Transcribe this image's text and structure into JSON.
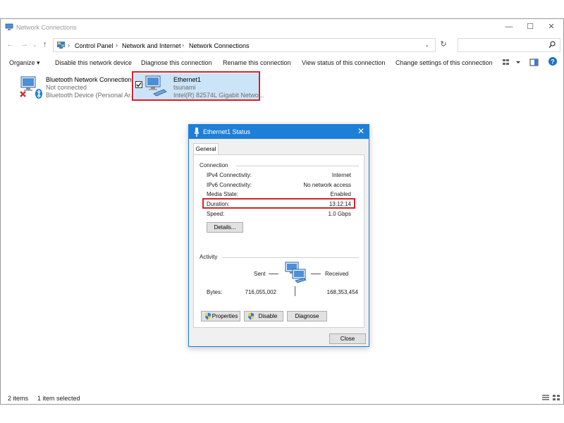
{
  "window": {
    "title": "Network Connections",
    "controls": {
      "minimize": "—",
      "maximize": "☐",
      "close": "✕"
    }
  },
  "address": {
    "crumbs": [
      "Control Panel",
      "Network and Internet",
      "Network Connections"
    ],
    "separator": "›",
    "dropdown": "⌄",
    "refresh": "↻",
    "search_placeholder": ""
  },
  "nav": {
    "back": "←",
    "forward": "→",
    "history": "⌄",
    "up": "↑"
  },
  "commands": {
    "organize": "Organize ▾",
    "disable": "Disable this network device",
    "diagnose": "Diagnose this connection",
    "rename": "Rename this connection",
    "view_status": "View status of this connection",
    "change_settings": "Change settings of this connection"
  },
  "connections": [
    {
      "name": "Bluetooth Network Connection",
      "status": "Not connected",
      "device": "Bluetooth Device (Personal Ar..."
    },
    {
      "name": "Ethernet1",
      "status": "tsunami",
      "device": "Intel(R) 82574L Gigabit Netwo..."
    }
  ],
  "statusbar": {
    "count": "2 items",
    "selected": "1 item selected"
  },
  "dialog": {
    "title": "Ethernet1 Status",
    "close": "✕",
    "tab": "General",
    "connection_group": "Connection",
    "rows": [
      {
        "label": "IPv4 Connectivity:",
        "value": "Internet"
      },
      {
        "label": "IPv6 Connectivity:",
        "value": "No network access"
      },
      {
        "label": "Media State:",
        "value": "Enabled"
      },
      {
        "label": "Duration:",
        "value": "13:12:14"
      },
      {
        "label": "Speed:",
        "value": "1.0 Gbps"
      }
    ],
    "details_button": "Details...",
    "activity_group": "Activity",
    "sent_label": "Sent",
    "received_label": "Received",
    "bytes_label": "Bytes:",
    "bytes_sent": "716,055,002",
    "bytes_received": "168,353,454",
    "properties_button": "Properties",
    "disable_button": "Disable",
    "diagnose_button": "Diagnose",
    "close_button": "Close"
  },
  "colors": {
    "accent": "#1e7fd8",
    "highlight": "#d2232a",
    "selection": "#cce4f7"
  }
}
